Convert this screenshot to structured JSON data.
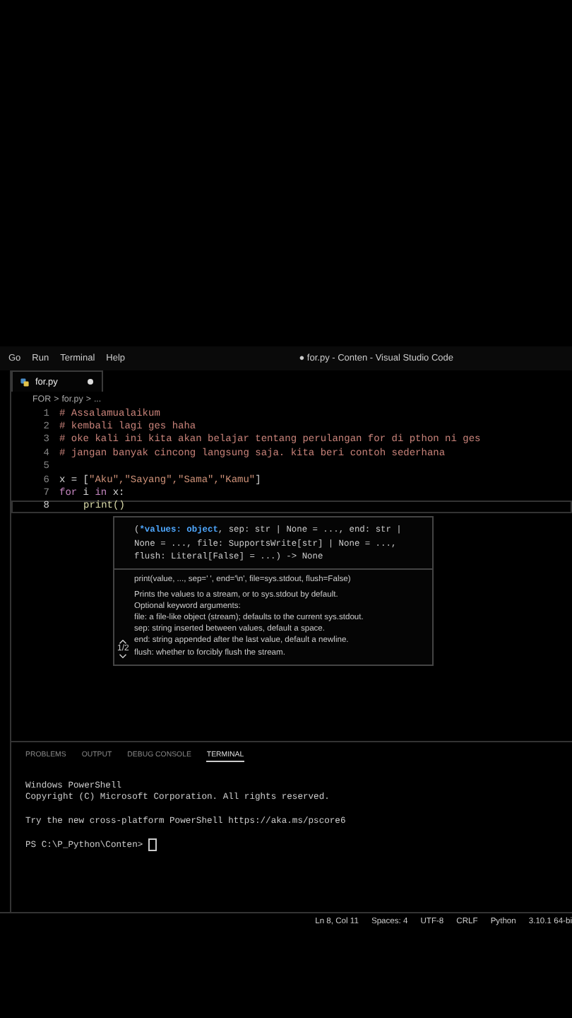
{
  "menu": [
    "Go",
    "Run",
    "Terminal",
    "Help"
  ],
  "window": {
    "title": "● for.py - Conten - Visual Studio Code"
  },
  "tabs": [
    {
      "label": "for.py",
      "selected": true,
      "modified": true
    }
  ],
  "breadcrumb": [
    "FOR",
    ">",
    "for.py",
    ">",
    "..."
  ],
  "code": [
    {
      "number": "1",
      "active": false,
      "indented": false,
      "tokens": [
        {
          "kind": "comment",
          "text": "# Assalamualaikum"
        }
      ]
    },
    {
      "number": "2",
      "active": false,
      "indented": false,
      "tokens": [
        {
          "kind": "comment",
          "text": "# kembali lagi ges haha"
        }
      ]
    },
    {
      "number": "3",
      "active": false,
      "indented": false,
      "tokens": [
        {
          "kind": "comment",
          "text": "# oke kali ini kita akan belajar tentang perulangan for di pthon ni ges"
        }
      ]
    },
    {
      "number": "4",
      "active": false,
      "indented": false,
      "tokens": [
        {
          "kind": "comment",
          "text": "# jangan banyak cincong langsung saja. kita beri contoh sederhana"
        }
      ]
    },
    {
      "number": "5",
      "active": false
    },
    {
      "number": "6",
      "active": false,
      "indented": false,
      "tokens": [
        {
          "kind": "plain",
          "text": "x = ["
        },
        {
          "kind": "string",
          "text": "\"Aku\",\"Sayang\",\"Sama\",\"Kamu\""
        },
        {
          "kind": "plain",
          "text": "]"
        }
      ]
    },
    {
      "number": "7",
      "active": false,
      "indented": false,
      "tokens": [
        {
          "kind": "keyword",
          "text": "for"
        },
        {
          "kind": "plain",
          "text": " i "
        },
        {
          "kind": "keyword",
          "text": "in"
        },
        {
          "kind": "plain",
          "text": " x:"
        }
      ]
    },
    {
      "number": "8",
      "active": true,
      "indented": true,
      "tokens": [
        {
          "kind": "function",
          "text": "print()"
        }
      ]
    }
  ],
  "popup": {
    "prefix": "(",
    "active_param": "*values: object",
    "rest": ", sep: str | None = ..., end: str | None = ..., file: SupportsWrite[str] | None = ..., flush: Literal[False] = ...) -> None",
    "doc_signature": "print(value, ..., sep=' ', end='\\n', file=sys.stdout, flush=False)",
    "doc_lines": [
      "Prints the values to a stream, or to sys.stdout by default.",
      "Optional keyword arguments:",
      "file: a file-like object (stream); defaults to the current sys.stdout.",
      "sep: string inserted between values, default a space.",
      "end: string appended after the last value, default a newline.",
      "flush: whether to forcibly flush the stream."
    ],
    "overload": "1/2"
  },
  "panel_tabs": [
    {
      "label": "PROBLEMS",
      "selected": false
    },
    {
      "label": "OUTPUT",
      "selected": false
    },
    {
      "label": "DEBUG CONSOLE",
      "selected": false
    },
    {
      "label": "TERMINAL",
      "selected": true
    }
  ],
  "terminal": {
    "blocks": [
      [
        "Windows PowerShell",
        "Copyright (C) Microsoft Corporation. All rights reserved."
      ],
      [
        "Try the new cross-platform PowerShell https://aka.ms/pscore6"
      ]
    ],
    "prompt": "PS C:\\P_Python\\Conten>"
  },
  "status_bar": [
    "Ln 8, Col 11",
    "Spaces: 4",
    "UTF-8",
    "CRLF",
    "Python",
    "3.10.1 64-bi"
  ]
}
